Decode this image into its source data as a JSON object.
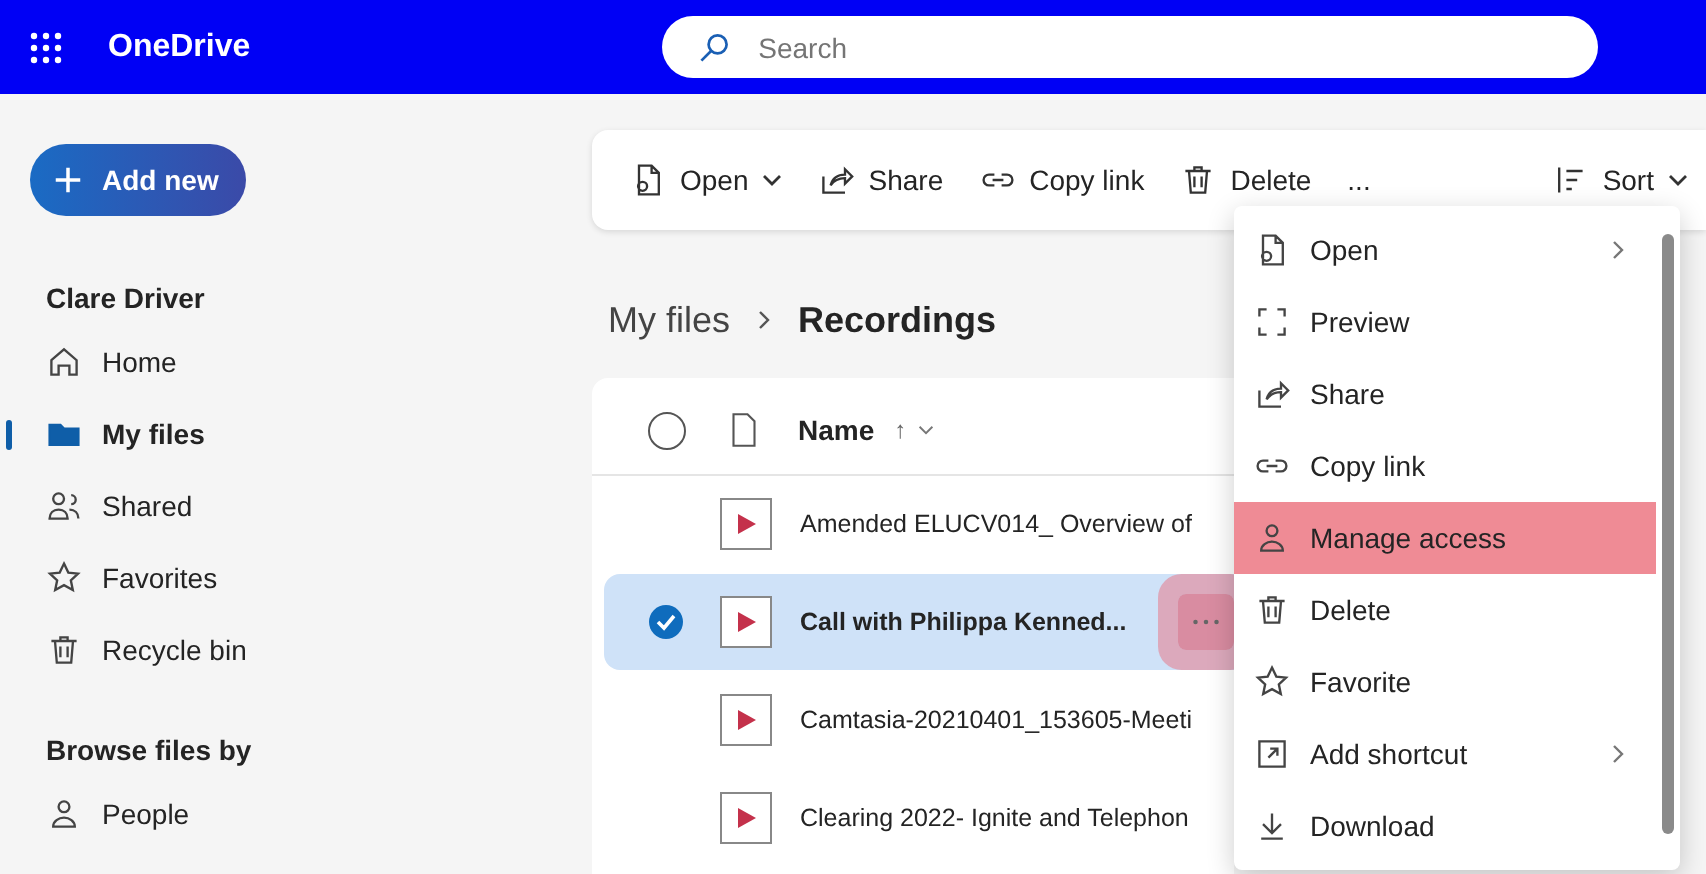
{
  "app": {
    "name": "OneDrive"
  },
  "search": {
    "placeholder": "Search"
  },
  "sidebar": {
    "add_button": "Add new",
    "user": "Clare Driver",
    "items": [
      {
        "label": "Home",
        "selected": false
      },
      {
        "label": "My files",
        "selected": true
      },
      {
        "label": "Shared",
        "selected": false
      },
      {
        "label": "Favorites",
        "selected": false
      },
      {
        "label": "Recycle bin",
        "selected": false
      }
    ],
    "browse_heading": "Browse files by",
    "browse_items": [
      {
        "label": "People",
        "selected": false
      }
    ]
  },
  "toolbar": [
    {
      "label": "Open",
      "dropdown": true
    },
    {
      "label": "Share",
      "dropdown": false
    },
    {
      "label": "Copy link",
      "dropdown": false
    },
    {
      "label": "Delete",
      "dropdown": false
    },
    {
      "label": "...",
      "dropdown": false
    }
  ],
  "sort": {
    "label": "Sort"
  },
  "breadcrumb": [
    "My files",
    "Recordings"
  ],
  "table": {
    "columns": [
      {
        "label": "Name",
        "sort": "↑"
      }
    ],
    "rows": [
      {
        "name": "Amended ELUCV014_ Overview of",
        "selected": false,
        "more_highlighted": false
      },
      {
        "name": "Call with Philippa Kenned...",
        "selected": true,
        "more_highlighted": true
      },
      {
        "name": "Camtasia-20210401_153605-Meeti",
        "selected": false,
        "more_highlighted": false
      },
      {
        "name": "Clearing 2022- Ignite and Telephon",
        "selected": false,
        "more_highlighted": false
      }
    ]
  },
  "context_menu": {
    "items": [
      {
        "label": "Open",
        "submenu": true,
        "highlighted": false
      },
      {
        "label": "Preview",
        "submenu": false,
        "highlighted": false
      },
      {
        "label": "Share",
        "submenu": false,
        "highlighted": false
      },
      {
        "label": "Copy link",
        "submenu": false,
        "highlighted": false
      },
      {
        "label": "Manage access",
        "submenu": false,
        "highlighted": true
      },
      {
        "label": "Delete",
        "submenu": false,
        "highlighted": false
      },
      {
        "label": "Favorite",
        "submenu": false,
        "highlighted": false
      },
      {
        "label": "Add shortcut",
        "submenu": true,
        "highlighted": false
      },
      {
        "label": "Download",
        "submenu": false,
        "highlighted": false
      }
    ]
  }
}
